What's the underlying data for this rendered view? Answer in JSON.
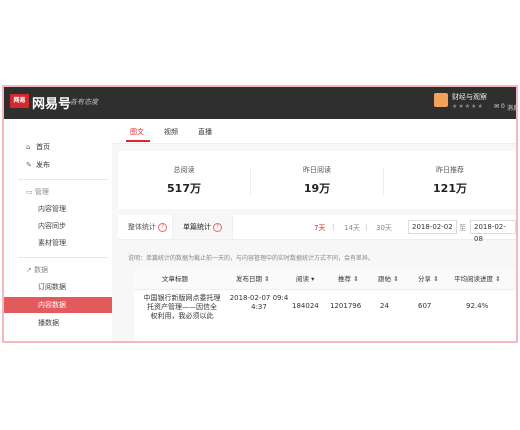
{
  "header": {
    "logo_text": "网易",
    "brand": "网易号",
    "slogan": "各有态度",
    "account": {
      "name": "财经与观察",
      "stars": "★★★★★",
      "count": "0",
      "message": "消息"
    }
  },
  "sidebar": {
    "items": [
      {
        "label": "首页",
        "icon": "home-icon"
      },
      {
        "label": "发布",
        "icon": "pen-icon"
      }
    ],
    "sections": [
      {
        "title": "管理",
        "icon": "folder-icon",
        "items": [
          "内容管理",
          "内容同步",
          "素材管理"
        ]
      },
      {
        "title": "数据",
        "icon": "chart-icon",
        "items": [
          "订阅数据",
          "内容数据",
          "播数据"
        ]
      }
    ]
  },
  "tabs": [
    "图文",
    "视频",
    "直播"
  ],
  "stats": [
    {
      "label": "总阅读",
      "value": "517万"
    },
    {
      "label": "昨日阅读",
      "value": "19万"
    },
    {
      "label": "昨日推荐",
      "value": "121万"
    }
  ],
  "filter": {
    "tab_overall": "整体统计",
    "tab_single": "单篇统计",
    "ranges": [
      "7天",
      "14天",
      "30天"
    ],
    "date_from": "2018-02-02",
    "to_label": "至",
    "date_to": "2018-02-08"
  },
  "note": "说明：单篇统计的数据为截止前一天的，与内容管理中的实时数据统计方式不同，会有差异。",
  "table": {
    "headers": [
      "文章标题",
      "发布日期",
      "阅读",
      "推荐",
      "跟帖",
      "分享",
      "平均阅读进度"
    ],
    "rows": [
      {
        "title_lines": [
          "中国银行新版网点委托理",
          "托资产管理——因信全",
          "权利用，我必须以此"
        ],
        "date_lines": [
          "2018-02-07 09:4",
          "4:37"
        ],
        "reads": "184024",
        "recommend": "1201796",
        "comments": "24",
        "shares": "607",
        "progress": "92.4%"
      }
    ]
  },
  "colors": {
    "accent": "#d6282d",
    "topbar": "#2f2f2f",
    "active_nav": "#e25a5e",
    "frame_border": "#f2b8be"
  }
}
